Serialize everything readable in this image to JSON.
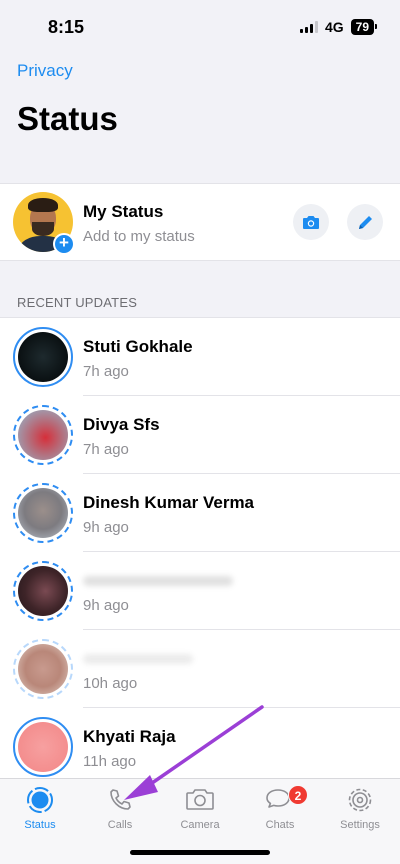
{
  "status_bar": {
    "time": "8:15",
    "network": "4G",
    "battery": "79"
  },
  "header": {
    "back_link": "Privacy",
    "title": "Status"
  },
  "my_status": {
    "name": "My Status",
    "subtitle": "Add to my status",
    "add_icon": "plus-icon",
    "camera_icon": "camera-icon",
    "edit_icon": "pencil-icon"
  },
  "recent_updates": {
    "header": "RECENT UPDATES",
    "items": [
      {
        "name": "Stuti Gokhale",
        "time": "7h ago",
        "blurred": false
      },
      {
        "name": "Divya Sfs",
        "time": "7h ago",
        "blurred": false
      },
      {
        "name": "Dinesh Kumar Verma",
        "time": "9h ago",
        "blurred": false
      },
      {
        "name": "",
        "time": "9h ago",
        "blurred": true
      },
      {
        "name": "",
        "time": "10h ago",
        "blurred": true
      },
      {
        "name": "Khyati Raja",
        "time": "11h ago",
        "blurred": false
      }
    ]
  },
  "tab_bar": {
    "tabs": [
      {
        "label": "Status",
        "icon": "status-icon",
        "active": true
      },
      {
        "label": "Calls",
        "icon": "phone-icon",
        "active": false
      },
      {
        "label": "Camera",
        "icon": "camera-icon",
        "active": false
      },
      {
        "label": "Chats",
        "icon": "chat-bubbles-icon",
        "active": false,
        "badge": "2"
      },
      {
        "label": "Settings",
        "icon": "gear-icon",
        "active": false
      }
    ]
  },
  "colors": {
    "accent": "#1d8cf0",
    "annotation_arrow": "#9b3fd6",
    "badge": "#f03a32"
  }
}
